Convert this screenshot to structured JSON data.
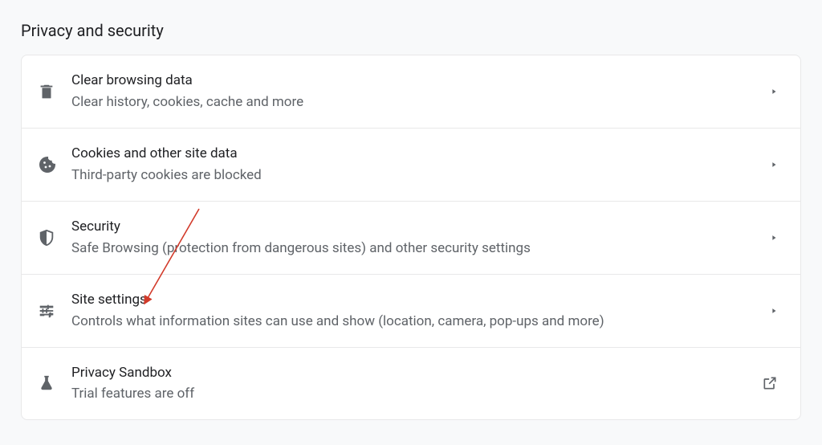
{
  "page": {
    "title": "Privacy and security"
  },
  "rows": [
    {
      "icon": "trash",
      "title": "Clear browsing data",
      "desc": "Clear history, cookies, cache and more",
      "trailing": "chevron"
    },
    {
      "icon": "cookie",
      "title": "Cookies and other site data",
      "desc": "Third-party cookies are blocked",
      "trailing": "chevron"
    },
    {
      "icon": "shield",
      "title": "Security",
      "desc": "Safe Browsing (protection from dangerous sites) and other security settings",
      "trailing": "chevron"
    },
    {
      "icon": "tune",
      "title": "Site settings",
      "desc": "Controls what information sites can use and show (location, camera, pop-ups and more)",
      "trailing": "chevron"
    },
    {
      "icon": "flask",
      "title": "Privacy Sandbox",
      "desc": "Trial features are off",
      "trailing": "external"
    }
  ],
  "annotation": {
    "color": "#d23a2a"
  }
}
